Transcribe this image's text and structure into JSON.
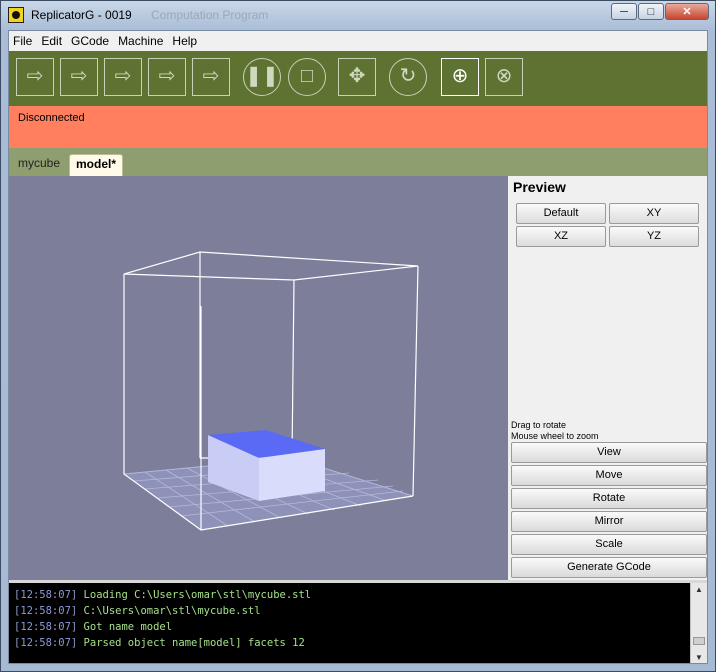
{
  "window": {
    "title": "ReplicatorG - 0019",
    "behind_title": "Computation Program",
    "minimize": "─",
    "maximize": "□",
    "close": "✕"
  },
  "menu": [
    "File",
    "Edit",
    "GCode",
    "Machine",
    "Help"
  ],
  "toolbar": {
    "buttons": [
      {
        "icon": "build-icon"
      },
      {
        "icon": "upload-icon"
      },
      {
        "icon": "build-to-file-icon"
      },
      {
        "icon": "build-from-file-icon"
      },
      {
        "icon": "build-remote-icon"
      },
      {
        "icon": "pause-icon"
      },
      {
        "icon": "stop-icon"
      },
      {
        "icon": "control-panel-icon"
      },
      {
        "icon": "reset-icon"
      },
      {
        "icon": "connect-icon"
      },
      {
        "icon": "disconnect-icon"
      }
    ]
  },
  "status": {
    "text": "Disconnected",
    "color": "#ff7f5e"
  },
  "tabs": [
    {
      "label": "mycube",
      "active": false
    },
    {
      "label": "model*",
      "active": true
    }
  ],
  "preview": {
    "title": "Preview",
    "view_buttons": [
      "Default",
      "XY",
      "XZ",
      "YZ"
    ],
    "hint_rotate": "Drag to rotate",
    "hint_zoom": "Mouse wheel to zoom",
    "actions": [
      "View",
      "Move",
      "Rotate",
      "Mirror",
      "Scale",
      "Generate GCode"
    ]
  },
  "console": {
    "lines": [
      {
        "time": "[12:58:07]",
        "message": "Loading C:\\Users\\omar\\stl\\mycube.stl"
      },
      {
        "time": "[12:58:07]",
        "message": "C:\\Users\\omar\\stl\\mycube.stl"
      },
      {
        "time": "[12:58:07]",
        "message": "Got name model"
      },
      {
        "time": "[12:58:07]",
        "message": "Parsed object name[model] facets 12"
      }
    ]
  },
  "colors": {
    "toolbar": "#5e7232",
    "tabstrip": "#8f9e6f",
    "viewport": "#7c7e9a",
    "model_top": "#5a6af5",
    "model_side": "#d6daf8"
  }
}
